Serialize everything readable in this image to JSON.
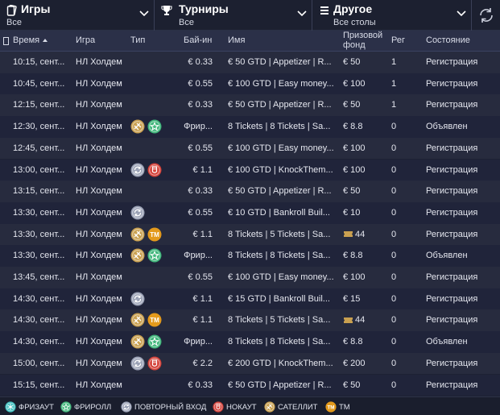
{
  "filters": {
    "games": {
      "title": "Игры",
      "value": "Все"
    },
    "tournaments": {
      "title": "Турниры",
      "value": "Все"
    },
    "other": {
      "title": "Другое",
      "value": "Все столы"
    }
  },
  "columns": {
    "time": "Время",
    "game": "Игра",
    "type": "Тип",
    "buyin": "Бай-ин",
    "name": "Имя",
    "prize_line1": "Призовой",
    "prize_line2": "фонд",
    "reg": "Рег",
    "state": "Состояние"
  },
  "colors": {
    "satellite": "#c9a050",
    "freeroll": "#3fb67a",
    "reentry": "#9aa1b5",
    "knockout": "#d4423a",
    "tm": "#e39a1c",
    "freezeout": "#3fbfbf"
  },
  "rows": [
    {
      "time": "10:15, сент...",
      "game": "НЛ Холдем",
      "types": [],
      "buyin": "€ 0.33",
      "name": "€ 50 GTD | Appetizer | R...",
      "prize": "€ 50",
      "prize_icon": "",
      "reg": "1",
      "state": "Регистрация"
    },
    {
      "time": "10:45, сент...",
      "game": "НЛ Холдем",
      "types": [],
      "buyin": "€ 0.55",
      "name": "€ 100 GTD | Easy money...",
      "prize": "€ 100",
      "prize_icon": "",
      "reg": "1",
      "state": "Регистрация"
    },
    {
      "time": "12:15, сент...",
      "game": "НЛ Холдем",
      "types": [],
      "buyin": "€ 0.33",
      "name": "€ 50 GTD | Appetizer | R...",
      "prize": "€ 50",
      "prize_icon": "",
      "reg": "1",
      "state": "Регистрация"
    },
    {
      "time": "12:30, сент...",
      "game": "НЛ Холдем",
      "types": [
        "satellite",
        "freeroll"
      ],
      "buyin": "Фрир...",
      "name": "8 Tickets | 8 Tickets | Sa...",
      "prize": "€ 8.8",
      "prize_icon": "",
      "reg": "0",
      "state": "Объявлен"
    },
    {
      "time": "12:45, сент...",
      "game": "НЛ Холдем",
      "types": [],
      "buyin": "€ 0.55",
      "name": "€ 100 GTD | Easy money...",
      "prize": "€ 100",
      "prize_icon": "",
      "reg": "0",
      "state": "Регистрация"
    },
    {
      "time": "13:00, сент...",
      "game": "НЛ Холдем",
      "types": [
        "reentry",
        "knockout"
      ],
      "buyin": "€ 1.1",
      "name": "€ 100 GTD | KnockThem...",
      "prize": "€ 100",
      "prize_icon": "",
      "reg": "0",
      "state": "Регистрация"
    },
    {
      "time": "13:15, сент...",
      "game": "НЛ Холдем",
      "types": [],
      "buyin": "€ 0.33",
      "name": "€ 50 GTD | Appetizer | R...",
      "prize": "€ 50",
      "prize_icon": "",
      "reg": "0",
      "state": "Регистрация"
    },
    {
      "time": "13:30, сент...",
      "game": "НЛ Холдем",
      "types": [
        "reentry"
      ],
      "buyin": "€ 0.55",
      "name": "€ 10 GTD | Bankroll Buil...",
      "prize": "€ 10",
      "prize_icon": "",
      "reg": "0",
      "state": "Регистрация"
    },
    {
      "time": "13:30, сент...",
      "game": "НЛ Холдем",
      "types": [
        "satellite",
        "tm"
      ],
      "buyin": "€ 1.1",
      "name": "8 Tickets | 5 Tickets | Sa...",
      "prize": "44",
      "prize_icon": "ticket",
      "reg": "0",
      "state": "Регистрация"
    },
    {
      "time": "13:30, сент...",
      "game": "НЛ Холдем",
      "types": [
        "satellite",
        "freeroll"
      ],
      "buyin": "Фрир...",
      "name": "8 Tickets | 8 Tickets | Sa...",
      "prize": "€ 8.8",
      "prize_icon": "",
      "reg": "0",
      "state": "Объявлен"
    },
    {
      "time": "13:45, сент...",
      "game": "НЛ Холдем",
      "types": [],
      "buyin": "€ 0.55",
      "name": "€ 100 GTD | Easy money...",
      "prize": "€ 100",
      "prize_icon": "",
      "reg": "0",
      "state": "Регистрация"
    },
    {
      "time": "14:30, сент...",
      "game": "НЛ Холдем",
      "types": [
        "reentry"
      ],
      "buyin": "€ 1.1",
      "name": "€ 15 GTD | Bankroll Buil...",
      "prize": "€ 15",
      "prize_icon": "",
      "reg": "0",
      "state": "Регистрация"
    },
    {
      "time": "14:30, сент...",
      "game": "НЛ Холдем",
      "types": [
        "satellite",
        "tm"
      ],
      "buyin": "€ 1.1",
      "name": "8 Tickets | 5 Tickets | Sa...",
      "prize": "44",
      "prize_icon": "ticket",
      "reg": "0",
      "state": "Регистрация"
    },
    {
      "time": "14:30, сент...",
      "game": "НЛ Холдем",
      "types": [
        "satellite",
        "freeroll"
      ],
      "buyin": "Фрир...",
      "name": "8 Tickets | 8 Tickets | Sa...",
      "prize": "€ 8.8",
      "prize_icon": "",
      "reg": "0",
      "state": "Объявлен"
    },
    {
      "time": "15:00, сент...",
      "game": "НЛ Холдем",
      "types": [
        "reentry",
        "knockout"
      ],
      "buyin": "€ 2.2",
      "name": "€ 200 GTD | KnockThem...",
      "prize": "€ 200",
      "prize_icon": "",
      "reg": "0",
      "state": "Регистрация"
    },
    {
      "time": "15:15, сент...",
      "game": "НЛ Холдем",
      "types": [],
      "buyin": "€ 0.33",
      "name": "€ 50 GTD | Appetizer | R...",
      "prize": "€ 50",
      "prize_icon": "",
      "reg": "0",
      "state": "Регистрация"
    }
  ],
  "legend": [
    {
      "key": "freezeout",
      "label": "ФРИЗАУТ"
    },
    {
      "key": "freeroll",
      "label": "ФРИРОЛЛ"
    },
    {
      "key": "reentry",
      "label": "ПОВТОРНЫЙ ВХОД"
    },
    {
      "key": "knockout",
      "label": "НОКАУТ"
    },
    {
      "key": "satellite",
      "label": "САТЕЛЛИТ"
    },
    {
      "key": "tm",
      "label": "ТМ"
    }
  ],
  "tm_badge_text": "TM"
}
